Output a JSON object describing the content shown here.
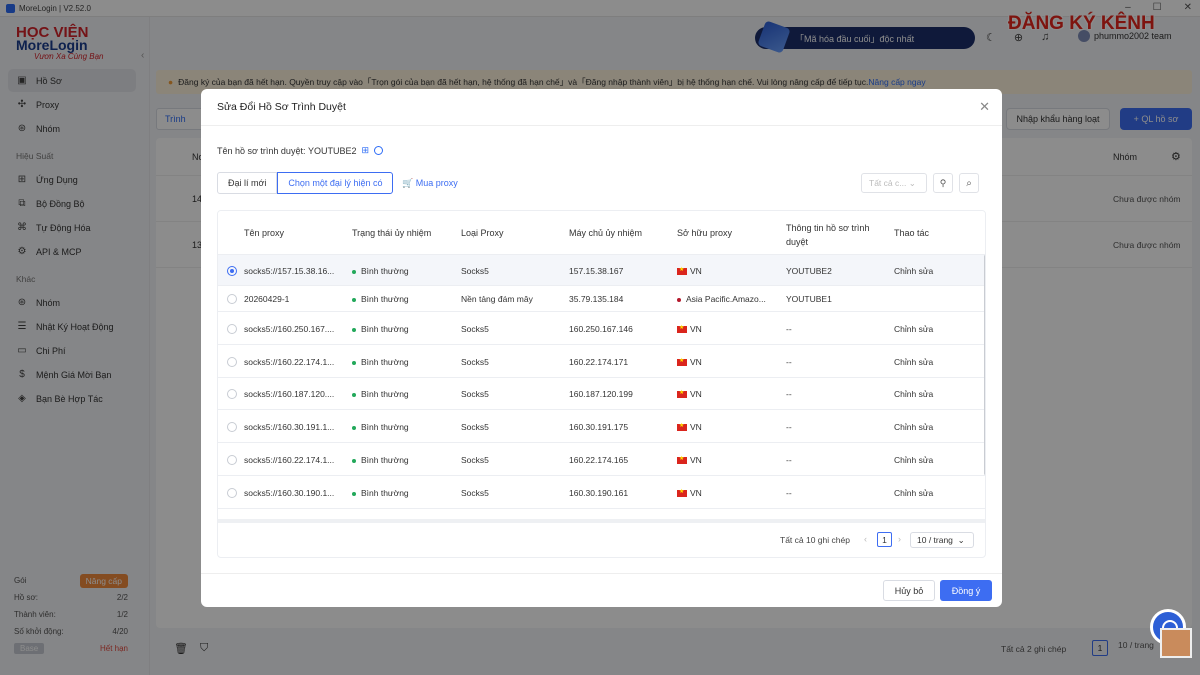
{
  "window": {
    "title": "MoreLogin | V2.52.0"
  },
  "brand": {
    "top": "HỌC VIỆN",
    "name": "MoreLogin",
    "slogan": "Vươn Xa Cùng Bạn"
  },
  "topbar": {
    "slogan": "「Mã hóa đầu cuối」độc nhất",
    "user": "phummo2002 team",
    "watermark": "ĐĂNG KÝ KÊNH"
  },
  "sidebar": {
    "items": [
      {
        "label": "Hồ Sơ",
        "icon": "profile-icon"
      },
      {
        "label": "Proxy",
        "icon": "proxy-icon"
      },
      {
        "label": "Nhóm",
        "icon": "group-icon"
      }
    ],
    "section1": "Hiệu Suất",
    "items2": [
      {
        "label": "Ứng Dụng",
        "icon": "apps-icon"
      },
      {
        "label": "Bộ Đồng Bộ",
        "icon": "sync-icon"
      },
      {
        "label": "Tự Động Hóa",
        "icon": "automation-icon"
      },
      {
        "label": "API & MCP",
        "icon": "api-icon"
      }
    ],
    "section2": "Khác",
    "items3": [
      {
        "label": "Nhóm",
        "icon": "team-icon"
      },
      {
        "label": "Nhật Ký Hoạt Động",
        "icon": "log-icon"
      },
      {
        "label": "Chi Phí",
        "icon": "cost-icon"
      },
      {
        "label": "Mệnh Giá Mời Bạn",
        "icon": "dollar-icon"
      },
      {
        "label": "Bạn Bè Hợp Tác",
        "icon": "partner-icon"
      }
    ],
    "plan": {
      "goi": "Gói",
      "upgrade": "Nâng cấp",
      "ho_so": "Hồ sơ:",
      "ho_so_val": "2/2",
      "thanh_vien": "Thành viên:",
      "thanh_vien_val": "1/2",
      "so_khoi_dong": "Số khởi động:",
      "so_khoi_dong_val": "4/20",
      "base": "Base",
      "expired": "Hết hạn"
    }
  },
  "notice": {
    "text": "Đăng ký của bạn đã hết hạn. Quyền truy cập vào「Trọn gói của bạn đã hết hạn, hệ thống đã hạn chế」và「Đăng nhập thành viên」bị hệ thống hạn chế. Vui lòng nâng cấp để tiếp tục.",
    "link": "Nâng cấp ngay"
  },
  "toolbar": {
    "tab": "Trình",
    "import": "Nhập khẩu hàng loạt",
    "manage": "+ QL hồ sơ"
  },
  "bg_table": {
    "col_no": "No",
    "col_group": "Nhóm",
    "rows": [
      {
        "no": "14",
        "group": "Chưa được nhóm"
      },
      {
        "no": "13",
        "group": "Chưa được nhóm"
      }
    ],
    "count": "Tất cả 2 ghi chép",
    "page": "1",
    "per_page": "10 / trang"
  },
  "modal": {
    "title": "Sửa Đổi Hồ Sơ Trình Duyệt",
    "profile_label": "Tên hồ sơ trình duyệt:",
    "profile_name": "YOUTUBE2",
    "seg_new": "Đại lí mới",
    "seg_existing": "Chọn một đại lý hiện có",
    "buy": "Mua proxy",
    "filter_placeholder": "Tất cả c...",
    "columns": [
      "Tên proxy",
      "Trạng thái ủy nhiệm",
      "Loại Proxy",
      "Máy chủ ủy nhiệm",
      "Sở hữu proxy",
      "Thông tin hồ sơ trình duyệt",
      "Thao tác"
    ],
    "rows": [
      {
        "name": "socks5://157.15.38.16...",
        "status": "Bình thường",
        "type": "Socks5",
        "host": "157.15.38.167",
        "owner": "VN",
        "profile": "YOUTUBE2",
        "action": "Chỉnh sửa",
        "selected": true
      },
      {
        "name": "20260429-1",
        "status": "Bình thường",
        "type": "Nền tảng đám mây",
        "host": "35.79.135.184",
        "owner": "Asia Pacific.Amazo...",
        "profile": "YOUTUBE1",
        "action": "",
        "selected": false
      },
      {
        "name": "socks5://160.250.167....",
        "status": "Bình thường",
        "type": "Socks5",
        "host": "160.250.167.146",
        "owner": "VN",
        "profile": "--",
        "action": "Chỉnh sửa",
        "selected": false
      },
      {
        "name": "socks5://160.22.174.1...",
        "status": "Bình thường",
        "type": "Socks5",
        "host": "160.22.174.171",
        "owner": "VN",
        "profile": "--",
        "action": "Chỉnh sửa",
        "selected": false
      },
      {
        "name": "socks5://160.187.120....",
        "status": "Bình thường",
        "type": "Socks5",
        "host": "160.187.120.199",
        "owner": "VN",
        "profile": "--",
        "action": "Chỉnh sửa",
        "selected": false
      },
      {
        "name": "socks5://160.30.191.1...",
        "status": "Bình thường",
        "type": "Socks5",
        "host": "160.30.191.175",
        "owner": "VN",
        "profile": "--",
        "action": "Chỉnh sửa",
        "selected": false
      },
      {
        "name": "socks5://160.22.174.1...",
        "status": "Bình thường",
        "type": "Socks5",
        "host": "160.22.174.165",
        "owner": "VN",
        "profile": "--",
        "action": "Chỉnh sửa",
        "selected": false
      },
      {
        "name": "socks5://160.30.190.1...",
        "status": "Bình thường",
        "type": "Socks5",
        "host": "160.30.190.161",
        "owner": "VN",
        "profile": "--",
        "action": "Chỉnh sửa",
        "selected": false
      }
    ],
    "count": "Tất cả 10 ghi chép",
    "page": "1",
    "per_page": "10 / trang",
    "cancel": "Hủy bỏ",
    "ok": "Đồng ý"
  }
}
